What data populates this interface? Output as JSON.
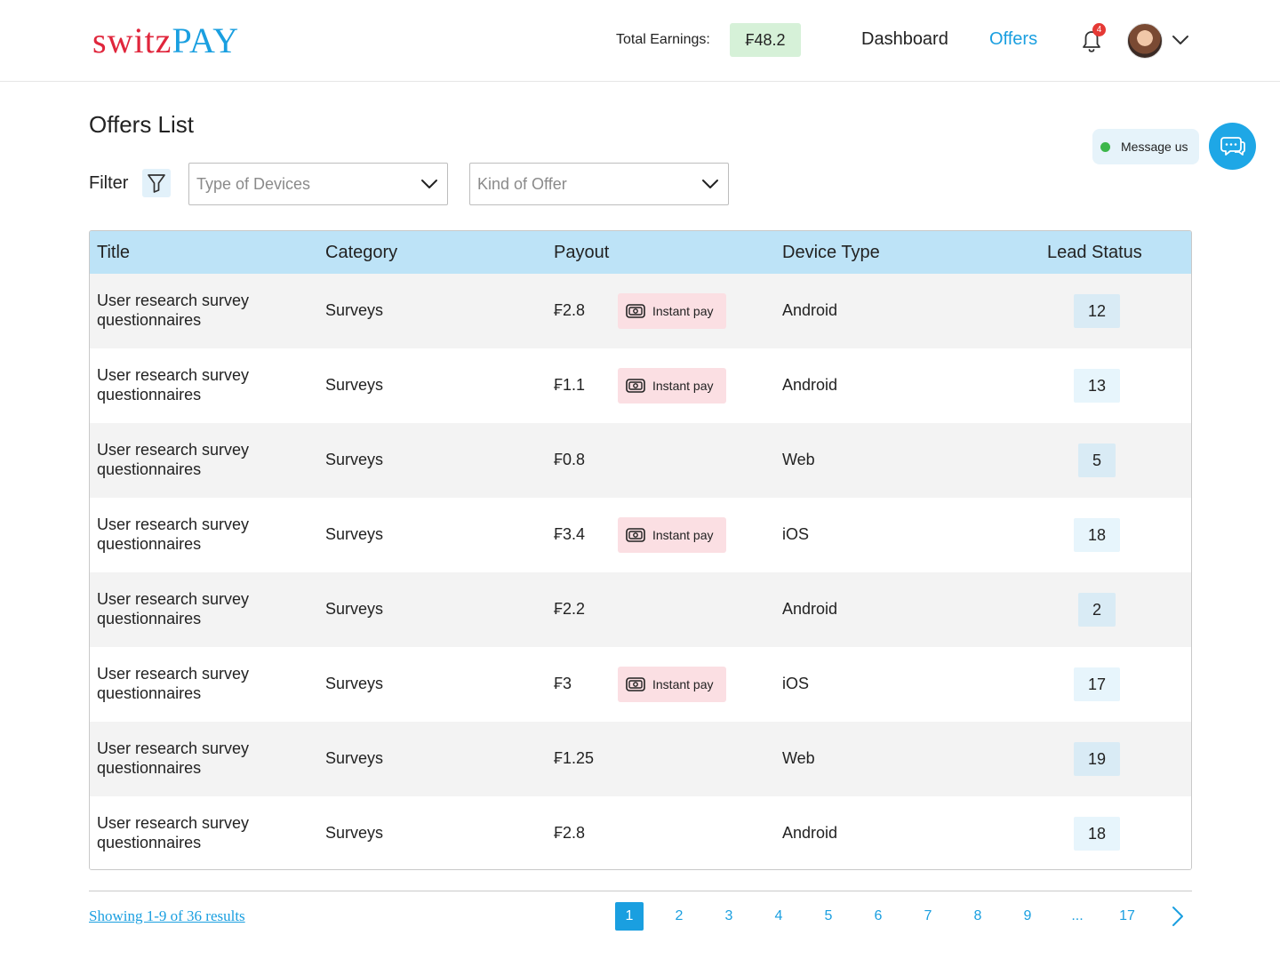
{
  "brand": {
    "logo_part1": "switz",
    "logo_part2": "PAY"
  },
  "header": {
    "earnings_label": "Total Earnings:",
    "earnings_value": "₣48.2",
    "nav_dashboard": "Dashboard",
    "nav_offers": "Offers",
    "notification_count": "4"
  },
  "page": {
    "title": "Offers List",
    "message_us": "Message us",
    "filter_label": "Filter",
    "device_placeholder": "Type of Devices",
    "offer_placeholder": "Kind of Offer"
  },
  "table": {
    "headers": {
      "title": "Title",
      "category": "Category",
      "payout": "Payout",
      "device": "Device Type",
      "lead": "Lead Status"
    },
    "instant_label": "Instant pay",
    "rows": [
      {
        "title": "User research survey questionnaires",
        "category": "Surveys",
        "payout": "₣2.8",
        "instant": true,
        "device": "Android",
        "lead": "12"
      },
      {
        "title": "User research survey questionnaires",
        "category": "Surveys",
        "payout": "₣1.1",
        "instant": true,
        "device": "Android",
        "lead": "13"
      },
      {
        "title": "User research survey questionnaires",
        "category": "Surveys",
        "payout": "₣0.8",
        "instant": false,
        "device": "Web",
        "lead": "5"
      },
      {
        "title": "User research survey questionnaires",
        "category": "Surveys",
        "payout": "₣3.4",
        "instant": true,
        "device": "iOS",
        "lead": "18"
      },
      {
        "title": "User research survey questionnaires",
        "category": "Surveys",
        "payout": "₣2.2",
        "instant": false,
        "device": "Android",
        "lead": "2"
      },
      {
        "title": "User research survey questionnaires",
        "category": "Surveys",
        "payout": "₣3",
        "instant": true,
        "device": "iOS",
        "lead": "17"
      },
      {
        "title": "User research survey questionnaires",
        "category": "Surveys",
        "payout": "₣1.25",
        "instant": false,
        "device": "Web",
        "lead": "19"
      },
      {
        "title": "User research survey questionnaires",
        "category": "Surveys",
        "payout": "₣2.8",
        "instant": false,
        "device": "Android",
        "lead": "18"
      }
    ]
  },
  "pagination": {
    "showing": "Showing 1-9 of 36 results",
    "pages": [
      "1",
      "2",
      "3",
      "4",
      "5",
      "6",
      "7",
      "8",
      "9",
      "...",
      "17"
    ],
    "active_page": "1"
  },
  "colors": {
    "accent": "#1a9fe0",
    "brand_red": "#e0263c",
    "earnings_bg": "#d6f1d8",
    "header_row": "#bde3f7",
    "instant_bg": "#fbdfe3"
  },
  "icons": {
    "notification": "bell-icon",
    "filter": "funnel-icon",
    "chat": "chat-bubble-icon",
    "instant": "cash-icon",
    "dropdown": "chevron-down-icon",
    "next": "chevron-right-icon"
  }
}
